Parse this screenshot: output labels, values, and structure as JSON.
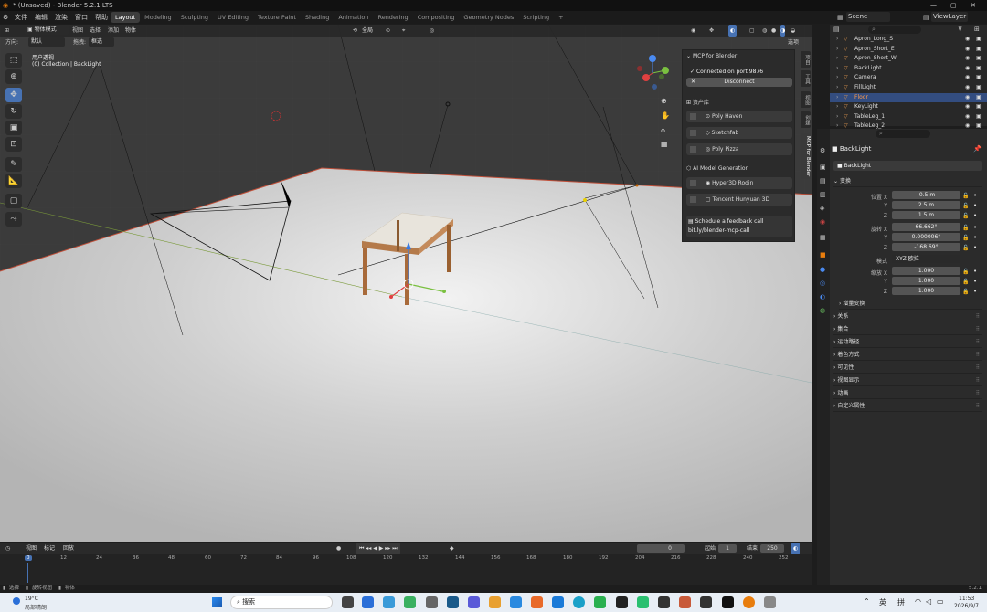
{
  "window": {
    "title": "* (Unsaved) - Blender 5.2.1 LTS"
  },
  "menu": [
    "文件",
    "编辑",
    "渲染",
    "窗口",
    "帮助"
  ],
  "workspaces": [
    "Layout",
    "Modeling",
    "Sculpting",
    "UV Editing",
    "Texture Paint",
    "Shading",
    "Animation",
    "Rendering",
    "Compositing",
    "Geometry Nodes",
    "Scripting"
  ],
  "active_workspace": "Layout",
  "scene": {
    "name": "Scene",
    "view_layer": "ViewLayer"
  },
  "viewport": {
    "mode": "物体模式",
    "menus": [
      "视图",
      "选择",
      "添加",
      "物体"
    ],
    "orientation_label": "方向:",
    "orientation_value": "默认",
    "drag_label": "拖拽:",
    "drag_value": "框选",
    "transform_global": "全局",
    "options": "选项",
    "view_name": "用户透视",
    "collection_info": "(0) Collection | BackLight"
  },
  "mcp": {
    "title": "MCP for Blender",
    "status": "Connected on port 9876",
    "disconnect": "Disconnect",
    "assets_title": "资产库",
    "assets": [
      "Poly Haven",
      "Sketchfab",
      "Poly Pizza"
    ],
    "ai_title": "AI Model Generation",
    "ai": [
      "Hyper3D Rodin",
      "Tencent Hunyuan 3D"
    ],
    "feedback": "Schedule a feedback call",
    "link": "bit.ly/blender-mcp-call"
  },
  "sidebar_tabs": [
    "项目",
    "工具",
    "视图",
    "创建",
    "MCP for Blender"
  ],
  "outliner": [
    {
      "name": "Apron_Long_S",
      "color": "#e69a4f"
    },
    {
      "name": "Apron_Short_E",
      "color": "#e69a4f"
    },
    {
      "name": "Apron_Short_W",
      "color": "#e69a4f"
    },
    {
      "name": "BackLight",
      "color": "#e69a4f"
    },
    {
      "name": "Camera",
      "color": "#e69a4f"
    },
    {
      "name": "FillLight",
      "color": "#e69a4f"
    },
    {
      "name": "Floor",
      "color": "#e69a4f"
    },
    {
      "name": "KeyLight",
      "color": "#e69a4f"
    },
    {
      "name": "TableLeg_1",
      "color": "#e69a4f"
    },
    {
      "name": "TableLeg_2",
      "color": "#e69a4f"
    }
  ],
  "properties": {
    "object_name": "BackLight",
    "object_name2": "BackLight",
    "transform_title": "变换",
    "location_label": "位置 X",
    "location": [
      "-0.5 m",
      "2.5 m",
      "1.5 m"
    ],
    "rotation_label": "旋转 X",
    "rotation": [
      "66.662°",
      "0.000006°",
      "-168.69°"
    ],
    "mode_label": "模式",
    "mode": "XYZ 欧拉",
    "scale_label": "缩放 X",
    "scale": [
      "1.000",
      "1.000",
      "1.000"
    ],
    "axis_y": "Y",
    "axis_z": "Z",
    "delta": "增量变换",
    "sections": [
      "关系",
      "集合",
      "运动路径",
      "着色方式",
      "可见性",
      "视图显示",
      "动画",
      "自定义属性"
    ]
  },
  "timeline": {
    "menus": [
      "视图",
      "标记",
      "回放"
    ],
    "current_frame": "0",
    "start_label": "起始",
    "start": "1",
    "end_label": "结束",
    "end": "250",
    "ticks": [
      "0",
      "12",
      "24",
      "36",
      "48",
      "60",
      "72",
      "84",
      "96",
      "108",
      "120",
      "132",
      "144",
      "156",
      "168",
      "180",
      "192",
      "204",
      "216",
      "228",
      "240",
      "252"
    ]
  },
  "statusbar": {
    "select": "选择",
    "rotate": "旋转视图",
    "object": "物体",
    "version": "5.2.1"
  },
  "taskbar": {
    "weather_temp": "19°C",
    "weather_desc": "局部晴朗",
    "search": "搜索",
    "ime1": "英",
    "ime2": "拼",
    "time": "11:53",
    "date": "2026/9/7"
  }
}
